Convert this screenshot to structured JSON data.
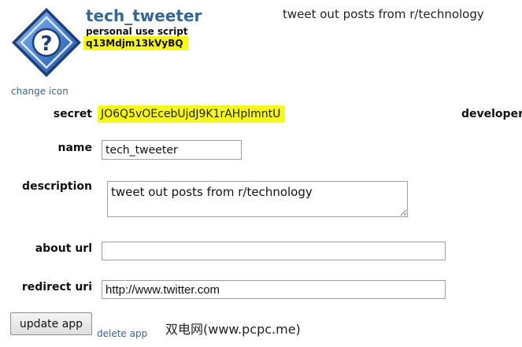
{
  "app": {
    "name": "tech_tweeter",
    "type": "personal use script",
    "client_id": "q13Mdjm13kVyBQ",
    "header_description": "tweet out posts from r/technology",
    "change_icon_label": "change icon",
    "icon": "question-mark-diamond-icon"
  },
  "form": {
    "secret_label": "secret",
    "secret_value": "JO6Q5vOEcebUjdJ9K1rAHplmntU",
    "developers_label": "developer",
    "name_label": "name",
    "name_value": "tech_tweeter",
    "description_label": "description",
    "description_value": "tweet out posts from r/technology",
    "about_url_label": "about url",
    "about_url_value": "",
    "redirect_uri_label": "redirect uri",
    "redirect_uri_value": "http://www.twitter.com"
  },
  "actions": {
    "update_label": "update app",
    "delete_label": "delete app"
  },
  "watermark": "双电网(www.pcpc.me)",
  "colors": {
    "link": "#336699",
    "highlight": "#f7f71a",
    "icon_blue": "#3a73c8"
  }
}
